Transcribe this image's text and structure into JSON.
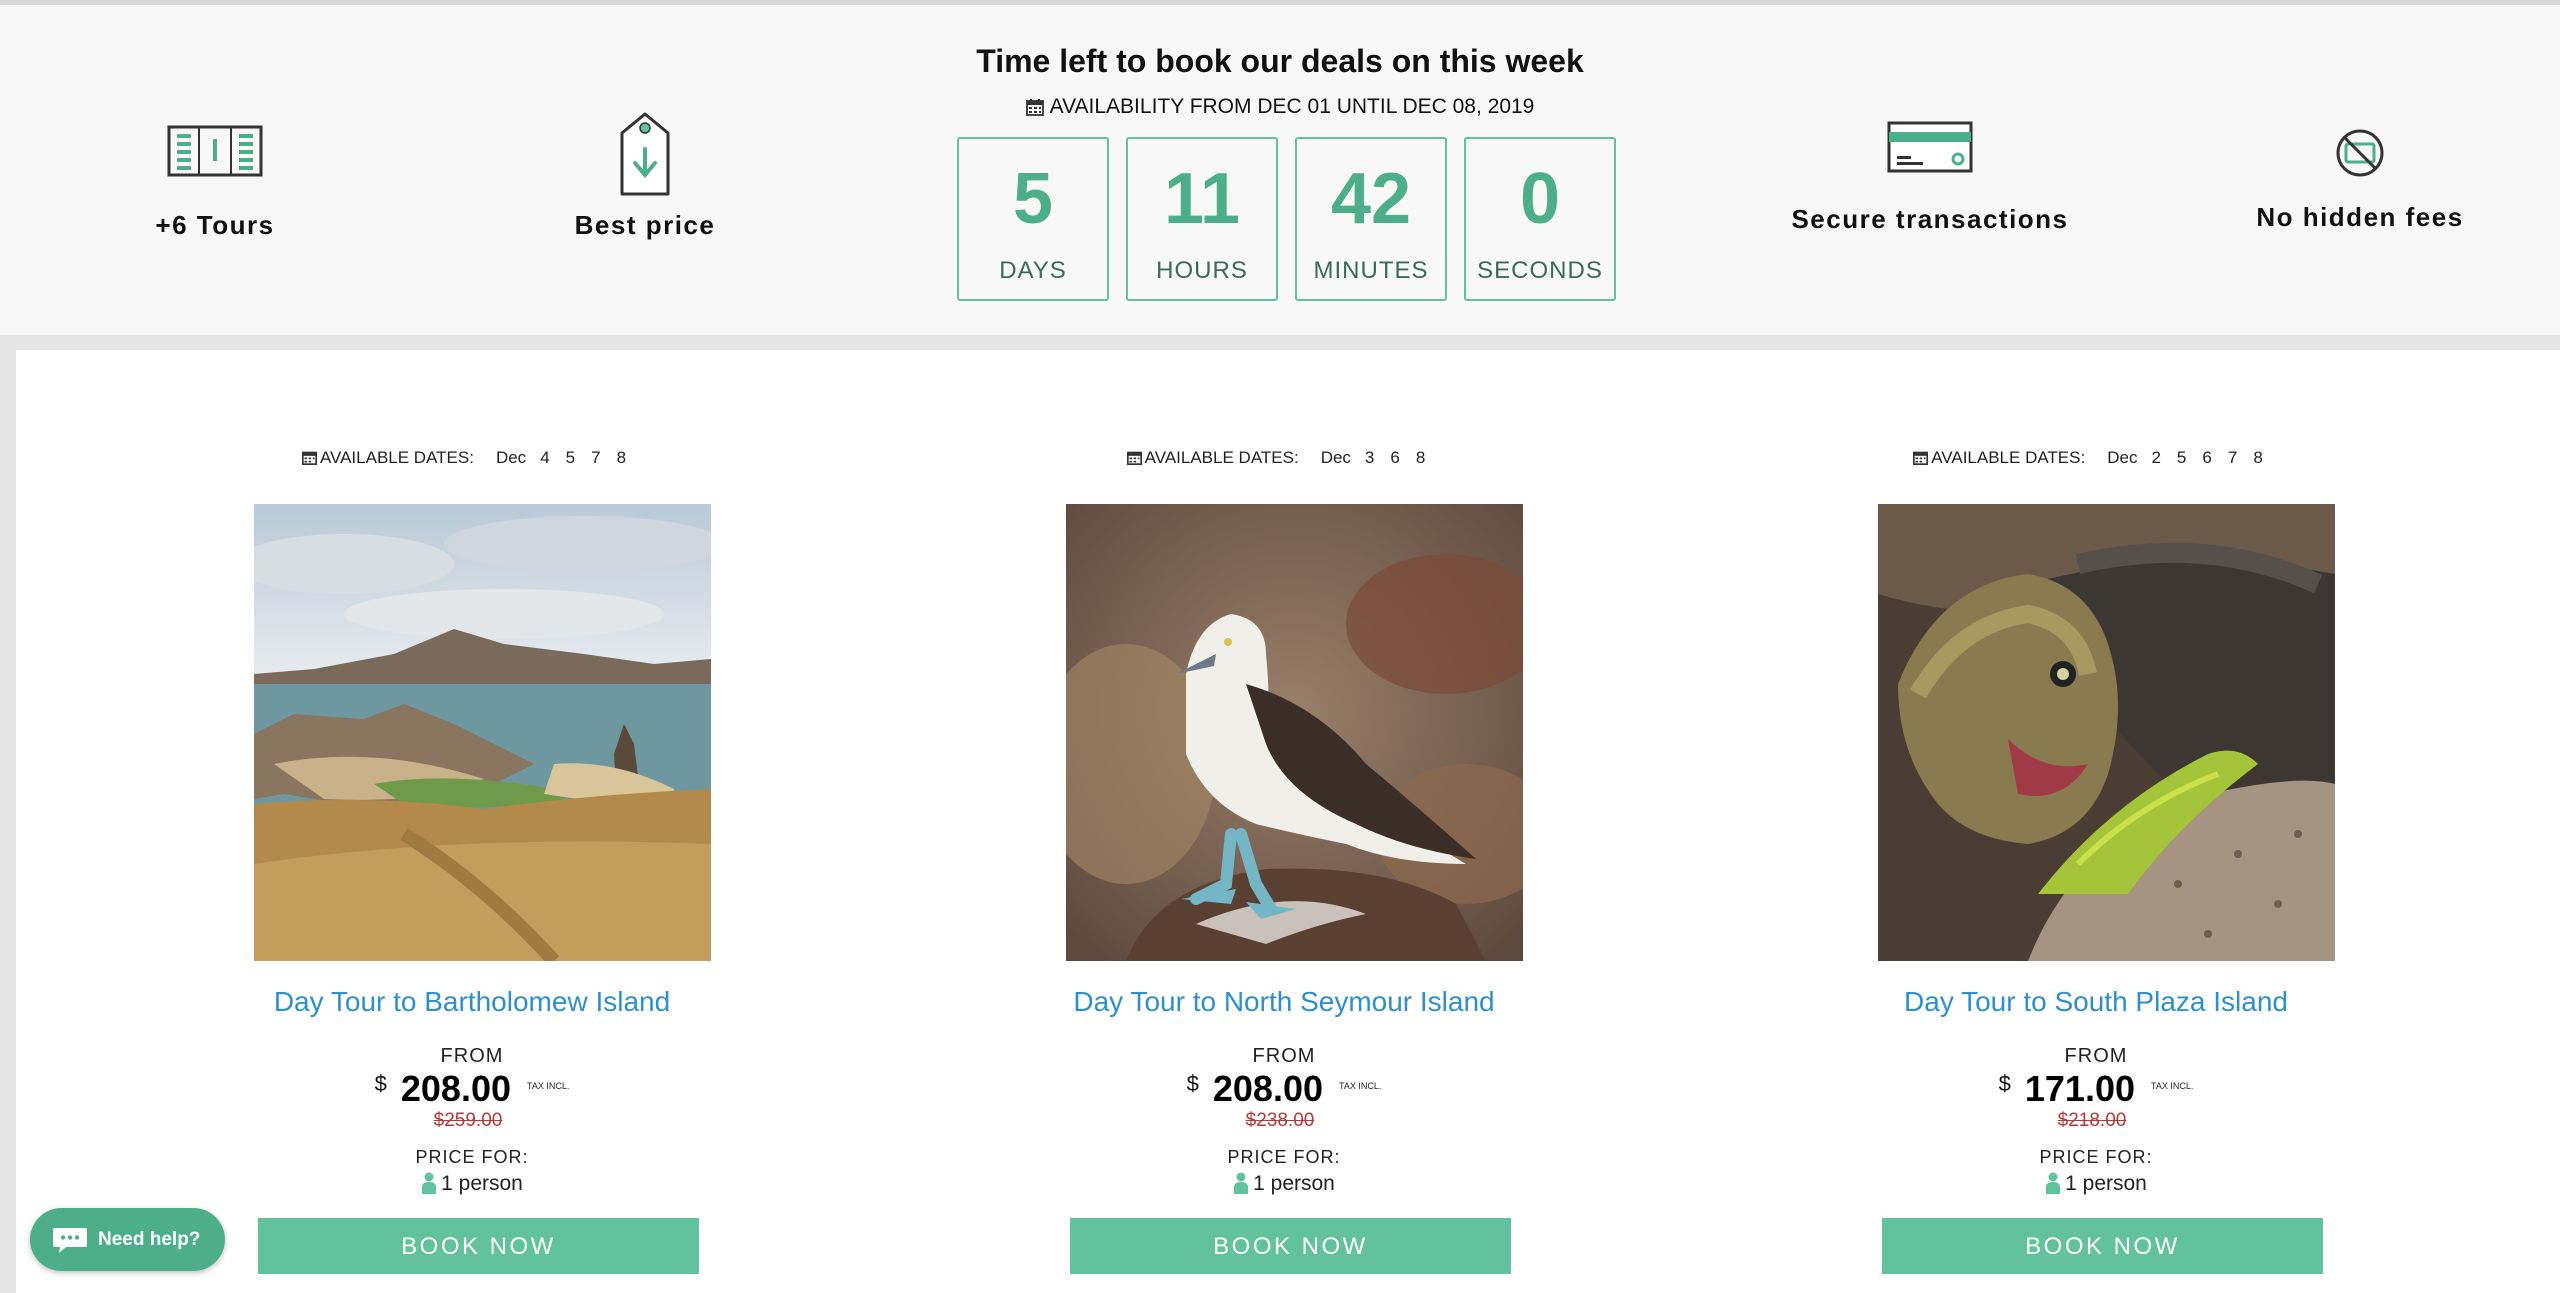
{
  "features": [
    {
      "label": "+6 Tours",
      "icon": "tours-icon"
    },
    {
      "label": "Best price",
      "icon": "price-tag-icon"
    },
    {
      "label": "Secure transactions",
      "icon": "credit-card-icon"
    },
    {
      "label": "No hidden fees",
      "icon": "no-fees-icon"
    }
  ],
  "deal": {
    "title": "Time left to book our deals on this week",
    "availability": "AVAILABILITY FROM DEC 01 UNTIL DEC 08, 2019",
    "countdown": [
      {
        "value": "5",
        "unit": "DAYS"
      },
      {
        "value": "11",
        "unit": "HOURS"
      },
      {
        "value": "42",
        "unit": "MINUTES"
      },
      {
        "value": "0",
        "unit": "SECONDS"
      }
    ]
  },
  "products": [
    {
      "dates_label": "AVAILABLE DATES:",
      "month": "Dec",
      "days": [
        "4",
        "5",
        "7",
        "8"
      ],
      "title": "Day Tour to Bartholomew Island",
      "from": "FROM",
      "currency": "$",
      "price": "208.00",
      "tax": "TAX INCL.",
      "old_price": "$259.00",
      "price_for": "PRICE FOR:",
      "persons": "1 person",
      "button": "BOOK NOW"
    },
    {
      "dates_label": "AVAILABLE DATES:",
      "month": "Dec",
      "days": [
        "3",
        "6",
        "8"
      ],
      "title": "Day Tour to North Seymour Island",
      "from": "FROM",
      "currency": "$",
      "price": "208.00",
      "tax": "TAX INCL.",
      "old_price": "$238.00",
      "price_for": "PRICE FOR:",
      "persons": "1 person",
      "button": "BOOK NOW"
    },
    {
      "dates_label": "AVAILABLE DATES:",
      "month": "Dec",
      "days": [
        "2",
        "5",
        "6",
        "7",
        "8"
      ],
      "title": "Day Tour to South Plaza Island",
      "from": "FROM",
      "currency": "$",
      "price": "171.00",
      "tax": "TAX INCL.",
      "old_price": "$218.00",
      "price_for": "PRICE FOR:",
      "persons": "1 person",
      "button": "BOOK NOW"
    }
  ],
  "help": {
    "label": "Need help?"
  },
  "colors": {
    "accent": "#62c29d",
    "link": "#2e8fcf",
    "old_price": "#b23a3a"
  }
}
